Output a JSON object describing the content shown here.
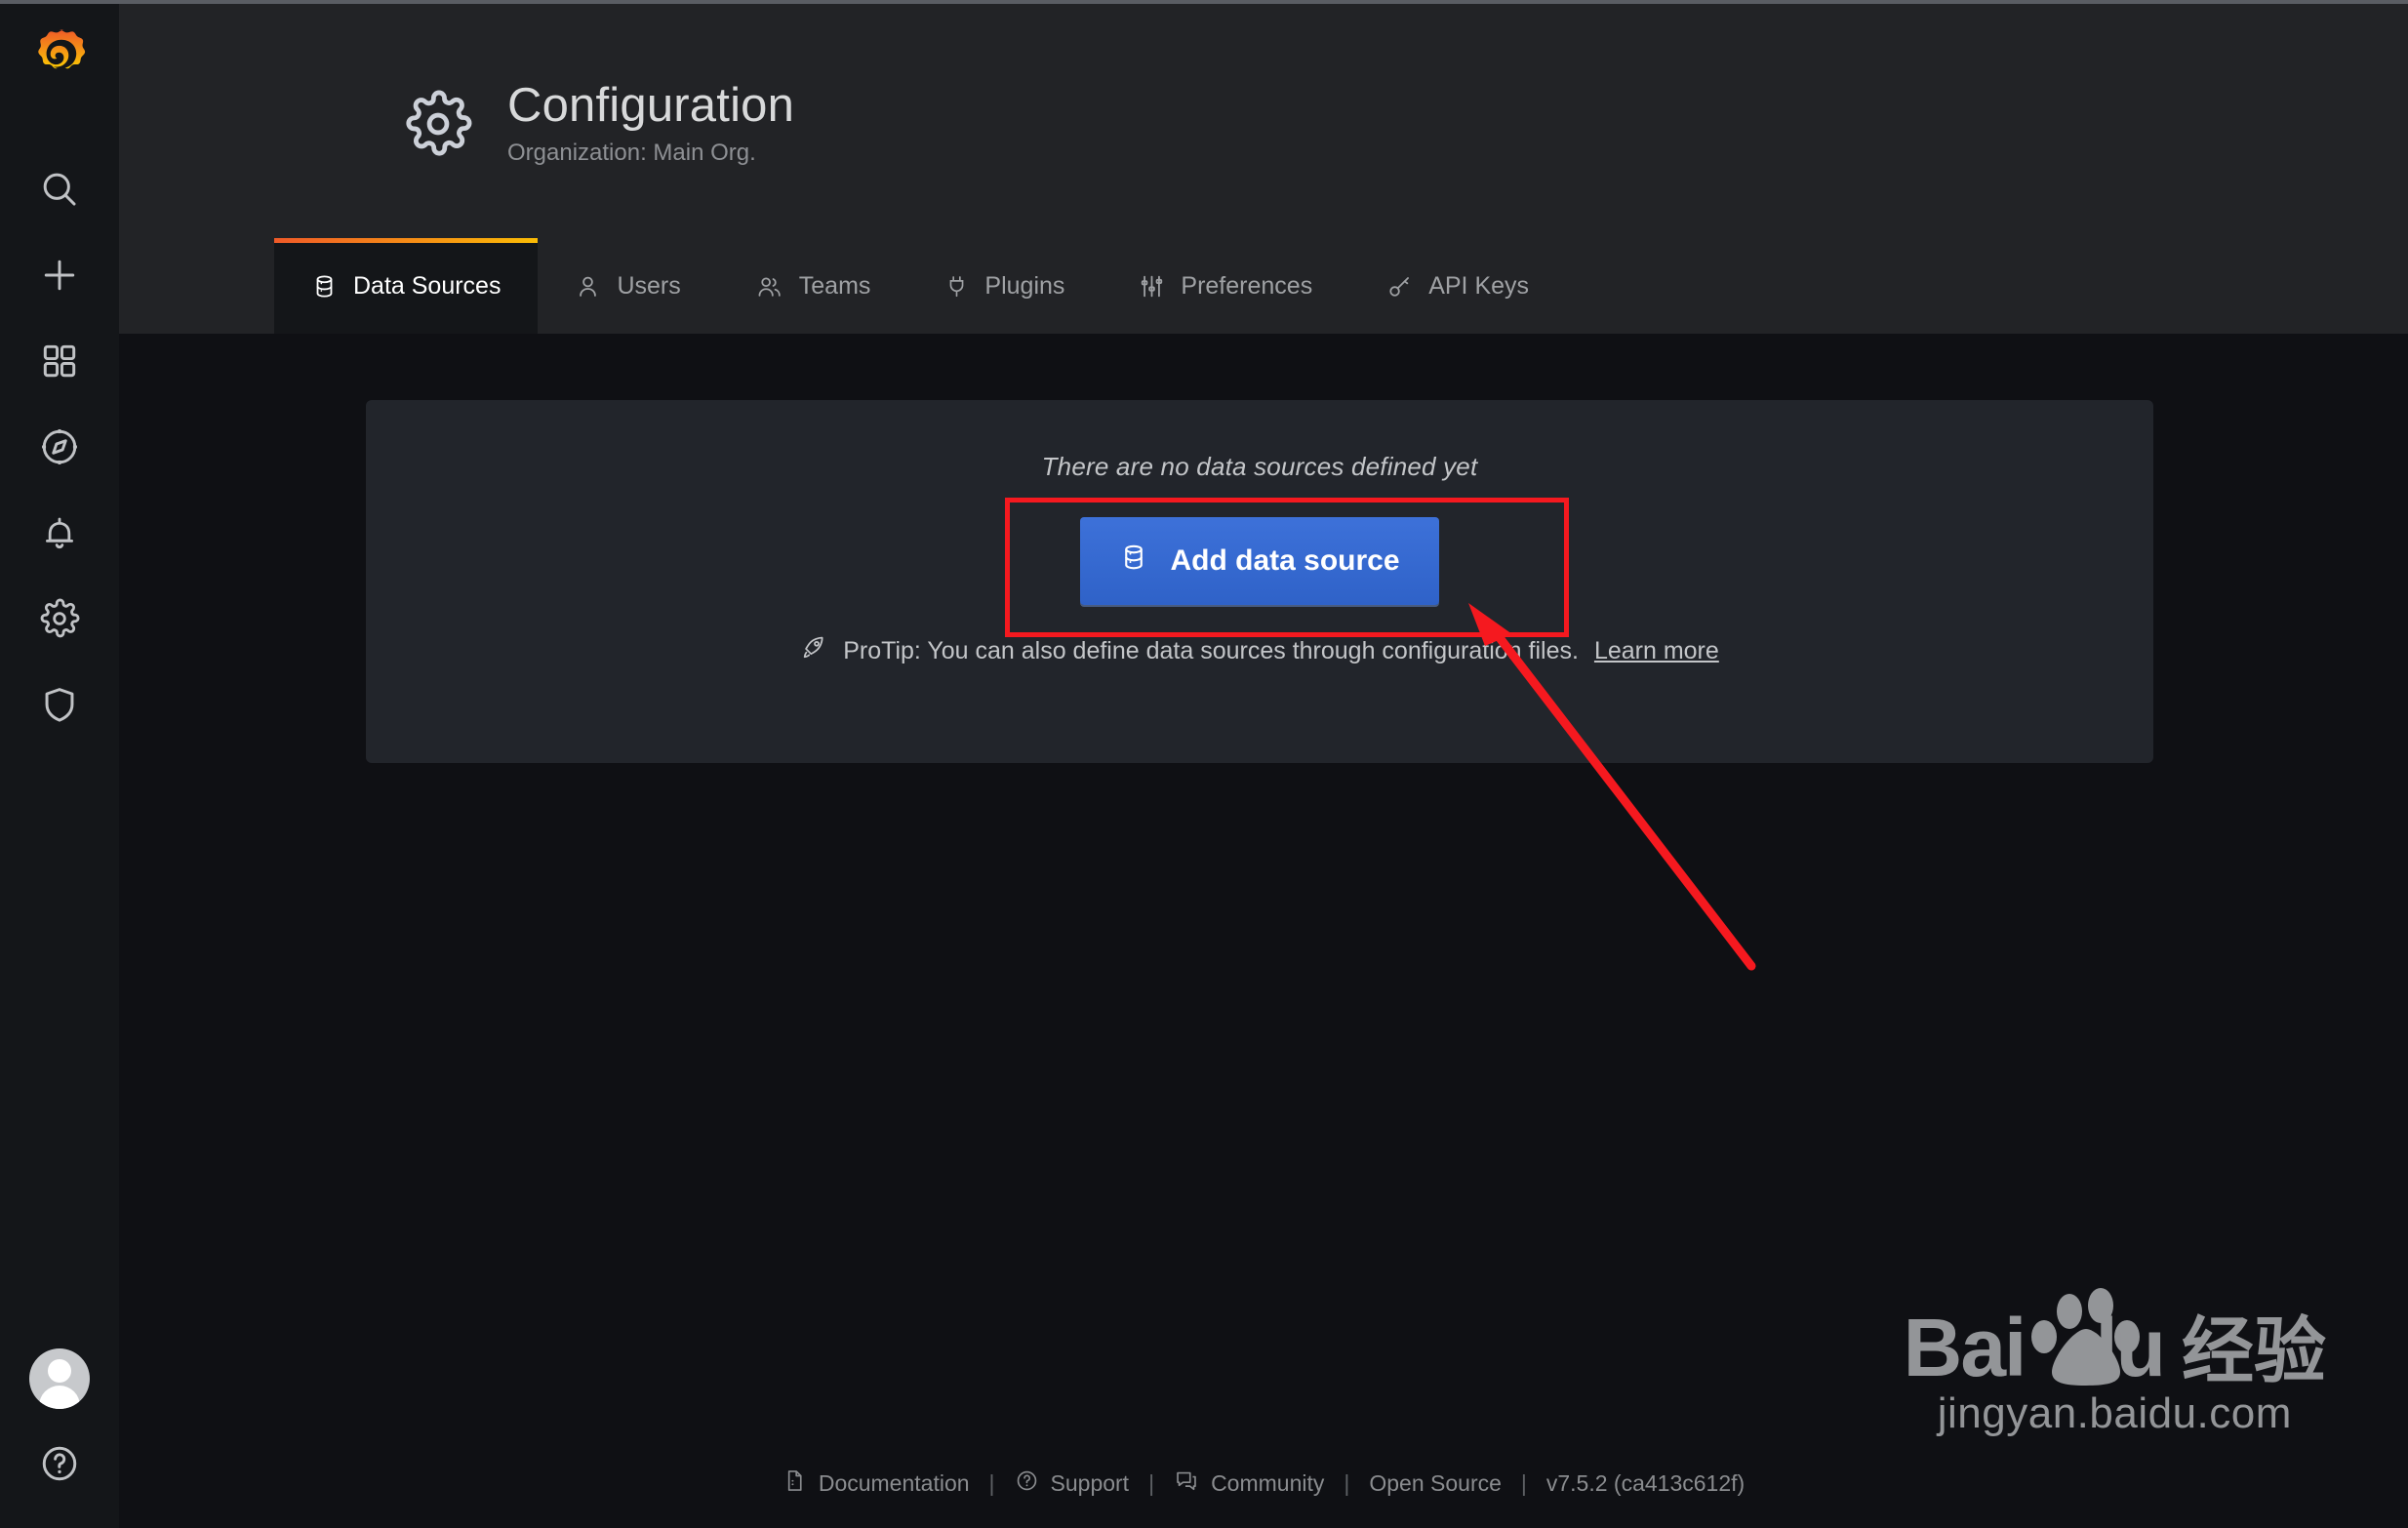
{
  "sidebar": {
    "brand_icon": "grafana-logo",
    "items": [
      {
        "id": "search",
        "icon": "search-icon"
      },
      {
        "id": "create",
        "icon": "plus-icon"
      },
      {
        "id": "dashboards",
        "icon": "apps-grid-icon"
      },
      {
        "id": "explore",
        "icon": "compass-icon"
      },
      {
        "id": "alerting",
        "icon": "bell-icon"
      },
      {
        "id": "configuration",
        "icon": "gear-icon"
      },
      {
        "id": "server-admin",
        "icon": "shield-icon"
      }
    ],
    "profile_icon": "user-avatar-icon",
    "help_icon": "question-circle-icon"
  },
  "header": {
    "icon": "gear-icon",
    "title": "Configuration",
    "subtitle": "Organization: Main Org."
  },
  "tabs": [
    {
      "label": "Data Sources",
      "icon": "database-icon",
      "active": true
    },
    {
      "label": "Users",
      "icon": "user-icon",
      "active": false
    },
    {
      "label": "Teams",
      "icon": "users-alt-icon",
      "active": false
    },
    {
      "label": "Plugins",
      "icon": "plug-icon",
      "active": false
    },
    {
      "label": "Preferences",
      "icon": "sliders-icon",
      "active": false
    },
    {
      "label": "API Keys",
      "icon": "key-icon",
      "active": false
    }
  ],
  "panel": {
    "empty_message": "There are no data sources defined yet",
    "add_button_label": "Add data source",
    "add_button_icon": "database-icon",
    "protip_icon": "rocket-icon",
    "protip_text": "ProTip: You can also define data sources through configuration files.",
    "protip_link_label": "Learn more"
  },
  "footer": {
    "links": [
      {
        "label": "Documentation",
        "icon": "document-icon"
      },
      {
        "label": "Support",
        "icon": "question-circle-icon"
      },
      {
        "label": "Community",
        "icon": "comments-icon"
      },
      {
        "label": "Open Source",
        "icon": ""
      }
    ],
    "separator": "|",
    "version": "v7.5.2 (ca413c612f)"
  },
  "watermark": {
    "brand_latin": "Bai",
    "brand_latin_2": "du",
    "brand_cn": "经验",
    "url": "jingyan.baidu.com"
  },
  "annotations": {
    "highlight_color": "#f5191f",
    "shapes": [
      "highlight-rectangle",
      "pointer-arrow"
    ]
  },
  "colors": {
    "accent_blue": "#3274d9",
    "tab_accent_start": "#f05a28",
    "tab_accent_end": "#fbbc05",
    "panel_bg": "#22252b",
    "header_bg": "#222326",
    "app_bg": "#0f1014",
    "sidebar_bg": "#141619"
  }
}
